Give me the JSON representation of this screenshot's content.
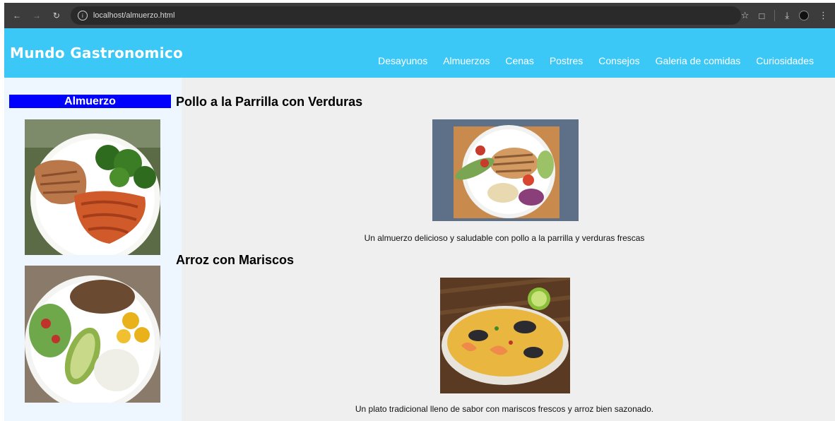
{
  "browser": {
    "url": "localhost/almuerzo.html",
    "icons": [
      "back-icon",
      "forward-icon",
      "reload-icon",
      "site-info-icon",
      "star-icon",
      "extensions-icon",
      "download-icon",
      "profile-icon",
      "menu-icon"
    ]
  },
  "site": {
    "logo": "Mundo Gastronomico",
    "header_color": "#3cc8f6",
    "nav": [
      {
        "label": "Desayunos"
      },
      {
        "label": "Almuerzos"
      },
      {
        "label": "Cenas"
      },
      {
        "label": "Postres"
      },
      {
        "label": "Consejos"
      },
      {
        "label": "Galeria de comidas"
      },
      {
        "label": "Curiosidades"
      }
    ]
  },
  "sidebar": {
    "title": "Almuerzo",
    "title_bg": "#0000ff",
    "images": [
      {
        "name": "chicken-pasta-broccoli-photo"
      },
      {
        "name": "rice-avocado-salad-photo"
      }
    ]
  },
  "dishes": [
    {
      "title": "Pollo a la Parrilla con Verduras",
      "caption": "Un almuerzo delicioso y saludable con pollo a la parrilla y verduras frescas"
    },
    {
      "title": "Arroz con Mariscos",
      "caption": "Un plato tradicional lleno de sabor con mariscos frescos y arroz bien sazonado."
    }
  ]
}
